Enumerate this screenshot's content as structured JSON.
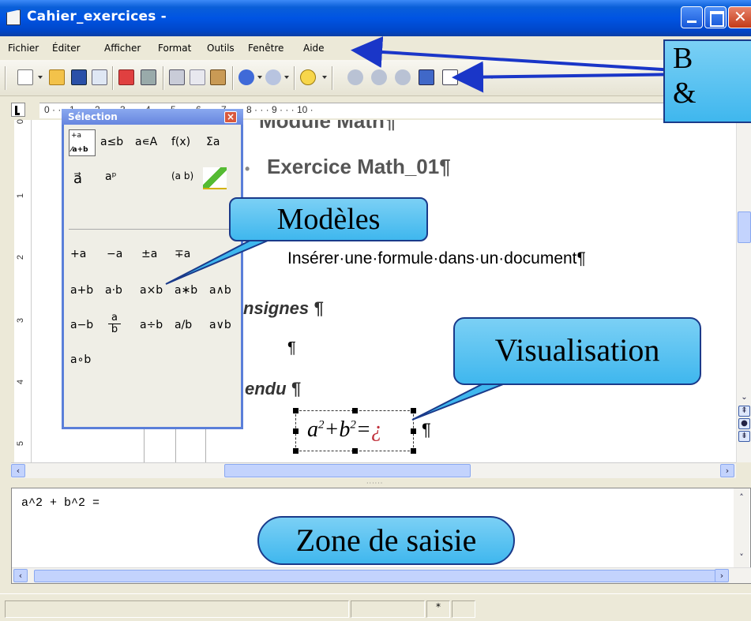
{
  "window": {
    "title": "Cahier_exercices -",
    "close_glyph": "✕"
  },
  "menu": [
    "Fichier",
    "Éditer",
    "Afficher",
    "Format",
    "Outils",
    "Fenêtre",
    "Aide"
  ],
  "ruler": {
    "horizontal": "0 · · · 1 · · · 2 · · · 3 · · · 4 · · · 5 · · · 6 · · · 7 · · · 8 · · · 9 · · · 10 ·",
    "vertical": [
      "0",
      "1",
      "2",
      "3",
      "4",
      "5"
    ]
  },
  "document": {
    "heading_top": "Module Math¶",
    "exercise_title": "Exercice Math_01¶",
    "instruction": "Insérer·une·formule·dans·un·document¶",
    "consignes": "nsignes ¶",
    "pilcrow": "¶",
    "attendu": "endu ¶",
    "formula_display": "a²+b²=¿",
    "formula_pilcrow": "¶"
  },
  "selection_window": {
    "title": "Sélection",
    "close": "×",
    "categories": [
      [
        "a≤b",
        "a∊A",
        "f(x)",
        "Σa"
      ],
      [
        "a⃗",
        "aᵖ",
        "(a b)"
      ]
    ],
    "operators": [
      [
        "+a",
        "−a",
        "±a",
        "∓a",
        "−"
      ],
      [
        "a+b",
        "a·b",
        "a×b",
        "a∗b",
        "a∧b"
      ],
      [
        "a−b",
        "a/b frac",
        "a÷b",
        "a/b",
        "a∨b"
      ],
      [
        "a∘b"
      ]
    ],
    "frac_num": "a",
    "frac_den": "b"
  },
  "formula_editor": {
    "text": "a^2 + b^2 ="
  },
  "statusbar": {
    "star": "*"
  },
  "callouts": {
    "bars_line1": "B",
    "bars_line2": "&",
    "modeles": "Modèles",
    "visualisation": "Visualisation",
    "zone": "Zone de saisie"
  },
  "colors": {
    "titlebar": "#0054e3",
    "callout": "#3fb7ee",
    "arrow": "#1a36c8",
    "formula_red": "#c0303a"
  }
}
